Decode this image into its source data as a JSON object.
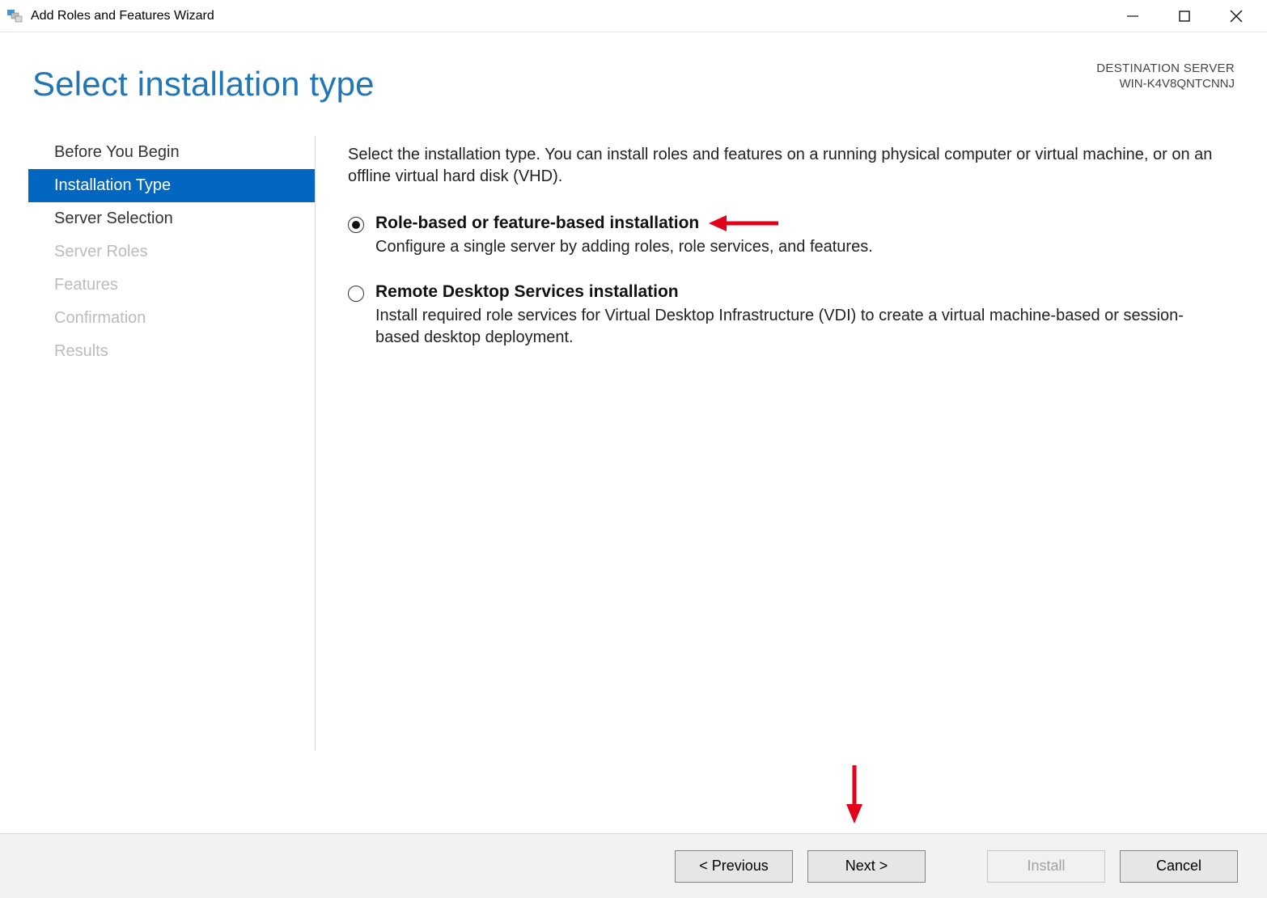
{
  "window": {
    "title": "Add Roles and Features Wizard"
  },
  "header": {
    "page_title": "Select installation type",
    "dest_label": "DESTINATION SERVER",
    "dest_name": "WIN-K4V8QNTCNNJ"
  },
  "sidebar": {
    "items": [
      {
        "label": "Before You Begin",
        "state": "enabled"
      },
      {
        "label": "Installation Type",
        "state": "selected"
      },
      {
        "label": "Server Selection",
        "state": "enabled"
      },
      {
        "label": "Server Roles",
        "state": "disabled"
      },
      {
        "label": "Features",
        "state": "disabled"
      },
      {
        "label": "Confirmation",
        "state": "disabled"
      },
      {
        "label": "Results",
        "state": "disabled"
      }
    ]
  },
  "content": {
    "intro": "Select the installation type. You can install roles and features on a running physical computer or virtual machine, or on an offline virtual hard disk (VHD).",
    "options": [
      {
        "title": "Role-based or feature-based installation",
        "desc": "Configure a single server by adding roles, role services, and features.",
        "selected": true
      },
      {
        "title": "Remote Desktop Services installation",
        "desc": "Install required role services for Virtual Desktop Infrastructure (VDI) to create a virtual machine-based or session-based desktop deployment.",
        "selected": false
      }
    ]
  },
  "footer": {
    "previous": "< Previous",
    "next": "Next >",
    "install": "Install",
    "cancel": "Cancel"
  }
}
